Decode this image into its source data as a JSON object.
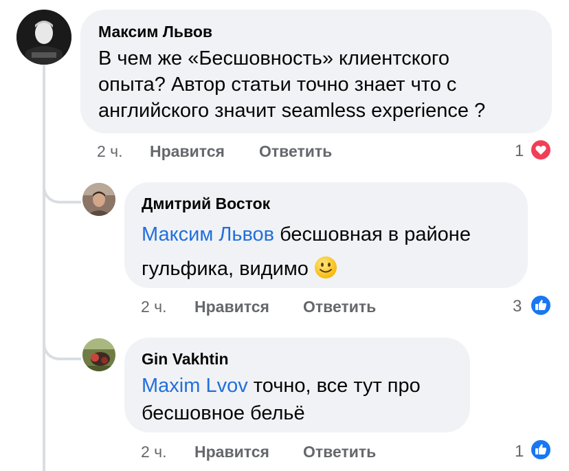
{
  "comments": [
    {
      "author": "Максим Львов",
      "text_lines": [
        "В чем же «Бесшовность» клиентского",
        "опыта? Автор статьи точно знает что с",
        "английского значит seamless experience ?"
      ],
      "time": "2 ч.",
      "like_label": "Нравится",
      "reply_label": "Ответить",
      "reaction_count": "1",
      "reaction_icon": "heart-reaction-icon"
    },
    {
      "author": "Дмитрий Восток",
      "mention": "Максим Львов",
      "text_after_mention": " бесшовная в районе",
      "text_line2": "гульфика, видимо ",
      "emoji": "slightly-smiling-face-emoji",
      "time": "2 ч.",
      "like_label": "Нравится",
      "reply_label": "Ответить",
      "reaction_count": "3",
      "reaction_icon": "like-reaction-icon"
    },
    {
      "author": "Gin Vakhtin",
      "mention": "Maxim Lvov",
      "text_after_mention": " точно, все тут про",
      "text_line2": "бесшовное бельё",
      "time": "2 ч.",
      "like_label": "Нравится",
      "reply_label": "Ответить",
      "reaction_count": "1",
      "reaction_icon": "like-reaction-icon"
    }
  ],
  "colors": {
    "bubble": "#f0f2f5",
    "mention": "#216fdb",
    "meta": "#65676b",
    "like_blue": "#1877f2",
    "heart_red": "#f33e58"
  }
}
